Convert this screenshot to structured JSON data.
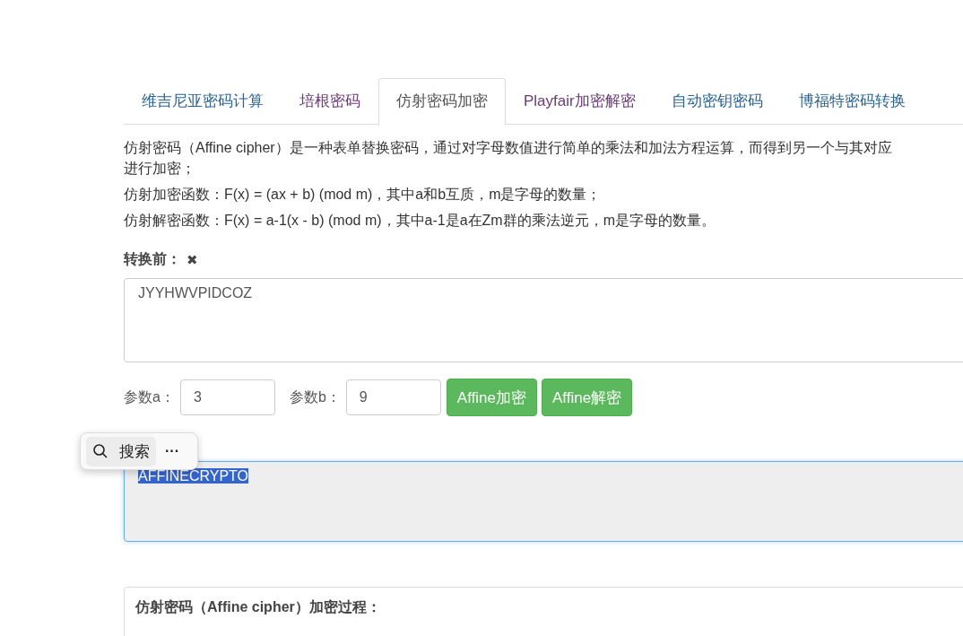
{
  "tabs": [
    {
      "label": "维吉尼亚密码计算",
      "selected": false,
      "visited": false
    },
    {
      "label": "培根密码",
      "selected": false,
      "visited": true
    },
    {
      "label": "仿射密码加密",
      "selected": true,
      "visited": false
    },
    {
      "label": "Playfair加密解密",
      "selected": false,
      "visited": true
    },
    {
      "label": "自动密钥密码",
      "selected": false,
      "visited": false
    },
    {
      "label": "博福特密码转换",
      "selected": false,
      "visited": false
    }
  ],
  "description": [
    "仿射密码（Affine cipher）是一种表单替换密码，通过对字母数值进行简单的乘法和加法方程运算，而得到另一个与其对应",
    "进行加密；"
  ],
  "formulas": [
    "仿射加密函数：F(x) = (ax + b) (mod m)，其中a和b互质，m是字母的数量；",
    "仿射解密函数：F(x) = a-1(x - b) (mod m)，其中a-1是a在Zm群的乘法逆元，m是字母的数量。"
  ],
  "input": {
    "label": "转换前：",
    "clear_icon": "✖",
    "value": "JYYHWVPIDCOZ"
  },
  "params": [
    {
      "label": "参数a：",
      "value": "3"
    },
    {
      "label": "参数b：",
      "value": "9"
    }
  ],
  "buttons": [
    "Affine加密",
    "Affine解密"
  ],
  "output": {
    "value": "AFFINECRYPTO",
    "selected": true
  },
  "popup": {
    "search": "搜索",
    "more": "···"
  },
  "process_panel": {
    "title": "仿射密码（Affine cipher）加密过程："
  }
}
